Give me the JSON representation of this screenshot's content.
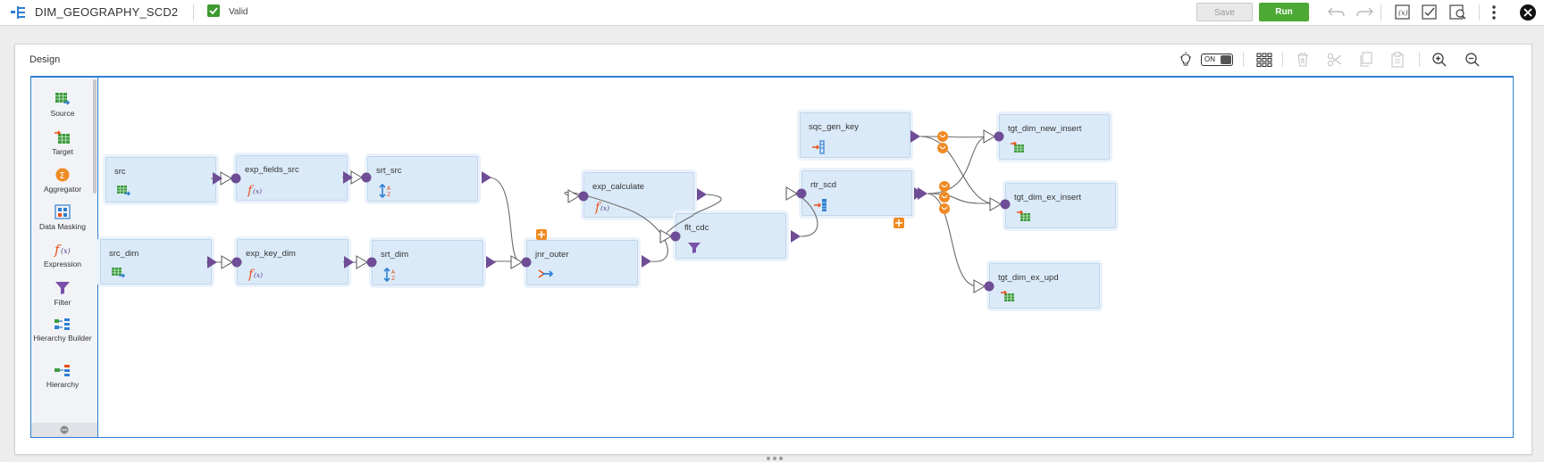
{
  "app": {
    "title": "DIM_GEOGRAPHY_SCD2",
    "status_label": "Valid",
    "save_label": "Save",
    "run_label": "Run"
  },
  "design": {
    "title": "Design",
    "toggle_label": "ON"
  },
  "palette": {
    "items": [
      {
        "label": "Source",
        "icon": "source-icon"
      },
      {
        "label": "Target",
        "icon": "target-icon"
      },
      {
        "label": "Aggregator",
        "icon": "aggregator-icon"
      },
      {
        "label": "Data Masking",
        "icon": "data-masking-icon"
      },
      {
        "label": "Expression",
        "icon": "expression-icon"
      },
      {
        "label": "Filter",
        "icon": "filter-icon"
      },
      {
        "label": "Hierarchy Builder",
        "icon": "hierarchy-builder-icon"
      },
      {
        "label": "Hierarchy",
        "icon": "hierarchy-icon"
      }
    ]
  },
  "nodes": {
    "src": "src",
    "exp_fields_src": "exp_fields_src",
    "srt_src": "srt_src",
    "src_dim": "src_dim",
    "exp_key_dim": "exp_key_dim",
    "srt_dim": "srt_dim",
    "jnr_outer": "jnr_outer",
    "exp_calculate": "exp_calculate",
    "flt_cdc": "flt_cdc",
    "sqc_gen_key": "sqc_gen_key",
    "rtr_scd": "rtr_scd",
    "tgt_dim_new_insert": "tgt_dim_new_insert",
    "tgt_dim_ex_insert": "tgt_dim_ex_insert",
    "tgt_dim_ex_upd": "tgt_dim_ex_upd"
  },
  "colors": {
    "accent_blue": "#2f7fd1",
    "run_green": "#4ba934",
    "port_purple": "#6f4d96",
    "node_fill": "#dbeaf8",
    "group_orange": "#f08a24"
  }
}
